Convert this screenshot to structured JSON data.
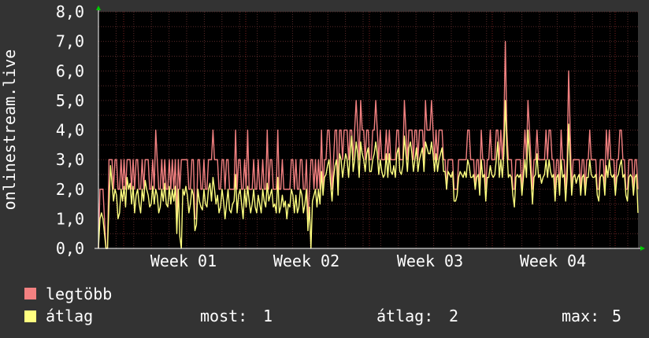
{
  "chart_data": {
    "type": "line",
    "ylabel": "onlinestream.live",
    "ylim": [
      0,
      8
    ],
    "yticks": [
      "0,0",
      "1,0",
      "2,0",
      "3,0",
      "4,0",
      "5,0",
      "6,0",
      "7,0",
      "8,0"
    ],
    "xticks": [
      "Week 01",
      "Week 02",
      "Week 03",
      "Week 04"
    ],
    "grid": true,
    "colors": {
      "background": "#333333",
      "plot": "#000000",
      "grid": "#5a2a2a",
      "legtobb": "#f38181",
      "atlag": "#ffff80",
      "arrow": "#00cc00"
    },
    "series": [
      {
        "name": "legtöbb",
        "color": "#f38181",
        "values": [
          0,
          2,
          2,
          2,
          1,
          0,
          0,
          3,
          3,
          3,
          2,
          3,
          3,
          2,
          2,
          3,
          2,
          3,
          2,
          3,
          3,
          3,
          2,
          3,
          2,
          3,
          3,
          2,
          2,
          3,
          2,
          3,
          3,
          3,
          2,
          2,
          3,
          2,
          4,
          3,
          2,
          2,
          3,
          2,
          3,
          2,
          2,
          3,
          2,
          3,
          2,
          3,
          1,
          3,
          2,
          3,
          3,
          3,
          3,
          3,
          2,
          2,
          3,
          3,
          1,
          1,
          3,
          3,
          2,
          2,
          3,
          2,
          2,
          3,
          3,
          3,
          4,
          3,
          3,
          3,
          2,
          2,
          3,
          3,
          2,
          3,
          3,
          2,
          2,
          2,
          2,
          4,
          2,
          3,
          3,
          2,
          2,
          3,
          2,
          4,
          2,
          2,
          2,
          3,
          2,
          2,
          3,
          2,
          2,
          3,
          2,
          2,
          4,
          2,
          3,
          3,
          2,
          2,
          2,
          4,
          2,
          2,
          3,
          2,
          2,
          2,
          2,
          2,
          3,
          3,
          2,
          3,
          2,
          2,
          3,
          3,
          2,
          2,
          3,
          1,
          2,
          3,
          3,
          2,
          3,
          2,
          3,
          2,
          4,
          2,
          3,
          3,
          4,
          4,
          3,
          2,
          3,
          4,
          4,
          2,
          4,
          4,
          3,
          4,
          4,
          4,
          3,
          4,
          4,
          3,
          4,
          5,
          4,
          3,
          5,
          4,
          4,
          3,
          4,
          4,
          3,
          3,
          4,
          4,
          5,
          4,
          3,
          4,
          3,
          3,
          3,
          4,
          3,
          4,
          3,
          3,
          3,
          3,
          4,
          4,
          3,
          3,
          3,
          5,
          4,
          3,
          4,
          4,
          4,
          3,
          4,
          4,
          3,
          4,
          4,
          4,
          3,
          5,
          4,
          4,
          4,
          5,
          4,
          3,
          4,
          3,
          4,
          4,
          4,
          3,
          3,
          2,
          3,
          3,
          3,
          3,
          2,
          2,
          2,
          3,
          3,
          3,
          3,
          3,
          3,
          4,
          4,
          3,
          3,
          3,
          2,
          3,
          3,
          2,
          4,
          3,
          3,
          2,
          3,
          3,
          4,
          3,
          3,
          3,
          4,
          4,
          3,
          4,
          3,
          4,
          7,
          4,
          3,
          3,
          3,
          2,
          2,
          3,
          3,
          3,
          3,
          2,
          3,
          4,
          3,
          5,
          4,
          3,
          2,
          3,
          3,
          4,
          3,
          3,
          3,
          3,
          3,
          4,
          3,
          4,
          4,
          3,
          3,
          2,
          3,
          3,
          2,
          4,
          3,
          3,
          2,
          3,
          6,
          4,
          2,
          3,
          3,
          3,
          3,
          3,
          2,
          3,
          3,
          2,
          3,
          3,
          4,
          3,
          3,
          3,
          3,
          2,
          2,
          3,
          3,
          3,
          2,
          4,
          3,
          4,
          3,
          3,
          3,
          2,
          3,
          3,
          4,
          4,
          3,
          3,
          2,
          2,
          3,
          3,
          3,
          2,
          3,
          3,
          2
        ]
      },
      {
        "name": "átlag",
        "color": "#ffff80",
        "values": [
          0,
          1,
          1.2,
          1,
          0.5,
          0,
          0,
          1.5,
          2.8,
          2.2,
          1.6,
          2,
          1.8,
          1,
          1.2,
          2,
          1.6,
          2.1,
          1.4,
          2.4,
          2,
          2.2,
          1.5,
          2.1,
          1.2,
          1.8,
          2,
          1.5,
          1.2,
          2,
          1.6,
          2.3,
          2,
          1.8,
          1.4,
          1.5,
          2.1,
          1.5,
          2,
          1.8,
          1.2,
          1.4,
          2,
          1.6,
          2.2,
          1.5,
          1.4,
          2.1,
          1.5,
          2,
          1.6,
          2.1,
          0.5,
          2,
          0.4,
          0,
          2,
          1.8,
          2.1,
          1.8,
          1.2,
          1.5,
          2,
          1.8,
          0.6,
          0.8,
          2,
          1.6,
          1.4,
          1.3,
          2,
          1.5,
          1.4,
          2,
          2.2,
          1.6,
          2.4,
          2,
          1.5,
          1.8,
          1.2,
          1.4,
          2,
          1.6,
          1,
          1.5,
          2,
          1.3,
          1.2,
          1.5,
          1.6,
          2.5,
          1.2,
          1.8,
          2,
          1.5,
          1,
          2,
          1.4,
          2.1,
          1.6,
          1.2,
          1.5,
          2,
          1.4,
          1.2,
          1.8,
          1.5,
          1.2,
          2,
          1.6,
          1.4,
          2.2,
          1.6,
          1.8,
          2,
          1.4,
          1.5,
          1.2,
          2.4,
          1.2,
          1.4,
          1.8,
          1.4,
          1.6,
          1,
          1.5,
          1.4,
          2,
          1.8,
          1.2,
          1.8,
          1.2,
          1.4,
          2,
          1.8,
          1.2,
          1.5,
          2,
          0.6,
          1.4,
          0,
          1.6,
          1.8,
          2,
          1.4,
          2,
          1.5,
          2.6,
          1.8,
          2.4,
          2.5,
          2.8,
          3,
          2.2,
          1.6,
          2.4,
          2.8,
          3,
          1.8,
          3.2,
          3,
          2.4,
          2.8,
          3.2,
          3,
          2.4,
          3.2,
          3.8,
          2.6,
          3,
          3.6,
          3.2,
          2.4,
          3.6,
          3.2,
          3,
          2.6,
          3.2,
          3.4,
          2.6,
          2.6,
          3,
          3.2,
          3.6,
          3.2,
          2.5,
          3,
          2.6,
          2.4,
          2.5,
          3.2,
          2.4,
          3.2,
          2.6,
          2.5,
          2.8,
          2.4,
          3.2,
          3.4,
          2.6,
          2.5,
          2.8,
          3.8,
          3.2,
          2.6,
          3.4,
          3.6,
          3.2,
          2.6,
          3,
          3.4,
          2.6,
          3,
          3.2,
          3.4,
          2.6,
          3.6,
          3.4,
          3.2,
          3.2,
          3.6,
          3.2,
          2.6,
          3.2,
          2.6,
          3,
          3.2,
          3.4,
          2.6,
          2.6,
          2,
          2.6,
          2.5,
          2.4,
          2.6,
          1.6,
          1.6,
          1.8,
          2.4,
          2.6,
          2.5,
          2.4,
          2.6,
          2.4,
          3,
          2.8,
          2.4,
          2.4,
          2.5,
          2,
          2.4,
          2.5,
          1.8,
          3,
          2.4,
          2.5,
          1.6,
          2.4,
          2.4,
          2.8,
          2.5,
          2.4,
          2.5,
          3,
          3.6,
          2.4,
          3,
          2.4,
          3.2,
          5,
          3.4,
          2.4,
          2.5,
          2.4,
          1.8,
          1.4,
          2.4,
          2.5,
          2.4,
          2.5,
          1.8,
          2.4,
          3,
          2.4,
          4,
          3.2,
          2.4,
          1.5,
          2.4,
          2.5,
          3.2,
          2.4,
          2.5,
          2.2,
          2.4,
          2.5,
          3,
          2.4,
          3,
          2.6,
          2.4,
          2.5,
          1.6,
          2.4,
          2.5,
          1.8,
          3,
          2.4,
          2.5,
          1.6,
          2.4,
          4.2,
          3,
          1.8,
          2.4,
          2.5,
          2.2,
          2.4,
          2.5,
          1.8,
          2.4,
          2.5,
          1.8,
          2.4,
          2.4,
          3,
          2.5,
          2.4,
          2.4,
          2.5,
          1.8,
          1.6,
          2.4,
          2.5,
          2.4,
          1.8,
          2.8,
          2.4,
          3,
          2.5,
          2.4,
          2.5,
          1.8,
          2.4,
          2.5,
          2.8,
          3,
          2.4,
          2.5,
          1.8,
          1.6,
          2.4,
          2.5,
          2.4,
          1.8,
          2.4,
          2.5,
          1.2
        ]
      }
    ]
  },
  "legend": {
    "items": [
      {
        "label": "legtöbb",
        "color": "#f38181"
      },
      {
        "label": "átlag",
        "color": "#ffff80"
      }
    ],
    "stats": {
      "most_label": "most:",
      "most_value": "1",
      "atlag_label": "átlag:",
      "atlag_value": "2",
      "max_label": "max:",
      "max_value": "5"
    }
  }
}
